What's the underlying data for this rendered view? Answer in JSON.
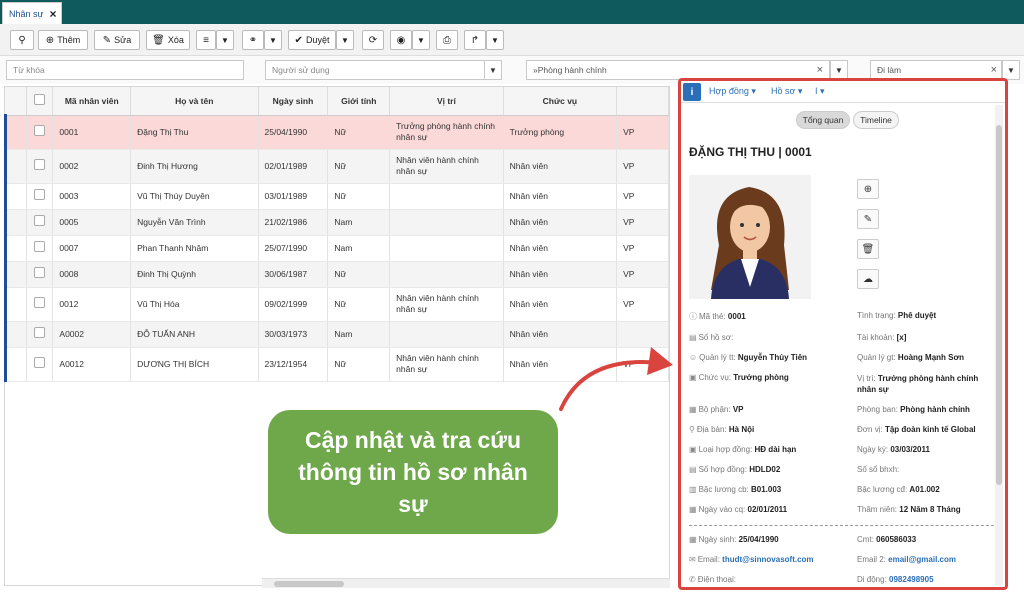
{
  "tab": {
    "label": "Nhân sự"
  },
  "toolbar": {
    "add_label": "Thêm",
    "edit_label": "Sửa",
    "delete_label": "Xóa",
    "approve_label": "Duyệt"
  },
  "filters": {
    "keyword_placeholder": "Từ khóa",
    "user_placeholder": "Người sử dụng",
    "department_value": "»Phòng hành chính",
    "status_value": "Đi làm"
  },
  "grid": {
    "columns": [
      "Mã nhân viên",
      "Họ và tên",
      "Ngày sinh",
      "Giới tính",
      "Vị trí",
      "Chức vụ"
    ],
    "rows": [
      {
        "id": "0001",
        "name": "Đặng Thị Thu",
        "dob": "25/04/1990",
        "gender": "Nữ",
        "position": "Trưởng phòng hành chính nhân sự",
        "title": "Trưởng phòng",
        "dept": "VP"
      },
      {
        "id": "0002",
        "name": "Đinh Thị Hương",
        "dob": "02/01/1989",
        "gender": "Nữ",
        "position": "Nhân viên hành chính nhân sự",
        "title": "Nhân viên",
        "dept": "VP"
      },
      {
        "id": "0003",
        "name": "Vũ Thị Thúy Duyên",
        "dob": "03/01/1989",
        "gender": "Nữ",
        "position": "",
        "title": "Nhân viên",
        "dept": "VP"
      },
      {
        "id": "0005",
        "name": "Nguyễn Văn Trình",
        "dob": "21/02/1986",
        "gender": "Nam",
        "position": "",
        "title": "Nhân viên",
        "dept": "VP"
      },
      {
        "id": "0007",
        "name": "Phan Thanh Nhâm",
        "dob": "25/07/1990",
        "gender": "Nam",
        "position": "",
        "title": "Nhân viên",
        "dept": "VP"
      },
      {
        "id": "0008",
        "name": "Đinh Thị Quỳnh",
        "dob": "30/06/1987",
        "gender": "Nữ",
        "position": "",
        "title": "Nhân viên",
        "dept": "VP"
      },
      {
        "id": "0012",
        "name": "Vũ Thị Hóa",
        "dob": "09/02/1999",
        "gender": "Nữ",
        "position": "Nhân viên hành chính nhân sự",
        "title": "Nhân viên",
        "dept": "VP"
      },
      {
        "id": "A0002",
        "name": "ĐỖ TUẤN ANH",
        "dob": "30/03/1973",
        "gender": "Nam",
        "position": "",
        "title": "Nhân viên",
        "dept": ""
      },
      {
        "id": "A0012",
        "name": "DƯƠNG THỊ BÍCH",
        "dob": "23/12/1954",
        "gender": "Nữ",
        "position": "Nhân viên hành chính nhân sự",
        "title": "Nhân viên",
        "dept": "VP"
      }
    ]
  },
  "panel": {
    "tabs": [
      "Hợp đồng ▾",
      "Hồ sơ ▾",
      "I ▾"
    ],
    "overview_label": "Tổng quan",
    "timeline_label": "Timeline",
    "title": "ĐẶNG THỊ THU | 0001",
    "fields": {
      "code_label": "Mã thẻ:",
      "code": "0001",
      "status_label": "Tình trạng:",
      "status": "Phê duyệt",
      "file_label": "Số hồ sơ:",
      "account_label": "Tài khoản:",
      "account": "[x]",
      "mgr_direct_label": "Quản lý tt:",
      "mgr_direct": "Nguyễn Thủy Tiên",
      "mgr_indirect_label": "Quản lý gt:",
      "mgr_indirect": "Hoàng Mạnh Sơn",
      "title_label": "Chức vụ:",
      "title": "Trưởng phòng",
      "position_label": "Vị trí:",
      "position": "Trưởng phòng hành chính nhân sự",
      "dept_label": "Bộ phận:",
      "dept": "VP",
      "room_label": "Phòng ban:",
      "room": "Phòng hành chính",
      "area_label": "Địa bàn:",
      "area": "Hà Nội",
      "unit_label": "Đơn vị:",
      "unit": "Tập đoàn kinh tế Global",
      "contract_type_label": "Loại hợp đồng:",
      "contract_type": "HĐ dài hạn",
      "sign_date_label": "Ngày ký:",
      "sign_date": "03/03/2011",
      "contract_no_label": "Số hợp đồng:",
      "contract_no": "HDLD02",
      "book_no_label": "Số sổ bhxh:",
      "salary_grade_label": "Bậc lương cb:",
      "salary_grade": "B01.003",
      "salary_grade2_label": "Bậc lương cđ:",
      "salary_grade2": "A01.002",
      "join_date_label": "Ngày vào cq:",
      "join_date": "02/01/2011",
      "seniority_label": "Thâm niên:",
      "seniority": "12 Năm 8 Tháng",
      "dob_label": "Ngày sinh:",
      "dob": "25/04/1990",
      "id_label": "Cmt:",
      "id": "060586033",
      "email_label": "Email:",
      "email": "thudt@sinnovasoft.com",
      "email2_label": "Email 2:",
      "email2": "email@gmail.com",
      "phone_label": "Điện thoại:",
      "mobile_label": "Di động:",
      "mobile": "0982498905"
    }
  },
  "callout": {
    "text": "Cập nhật và tra cứu thông tin hồ sơ nhân sự"
  },
  "colors": {
    "header": "#0e5a5c",
    "highlight": "#d9453e",
    "callout": "#6fa84a",
    "accent": "#2a6fb7"
  }
}
